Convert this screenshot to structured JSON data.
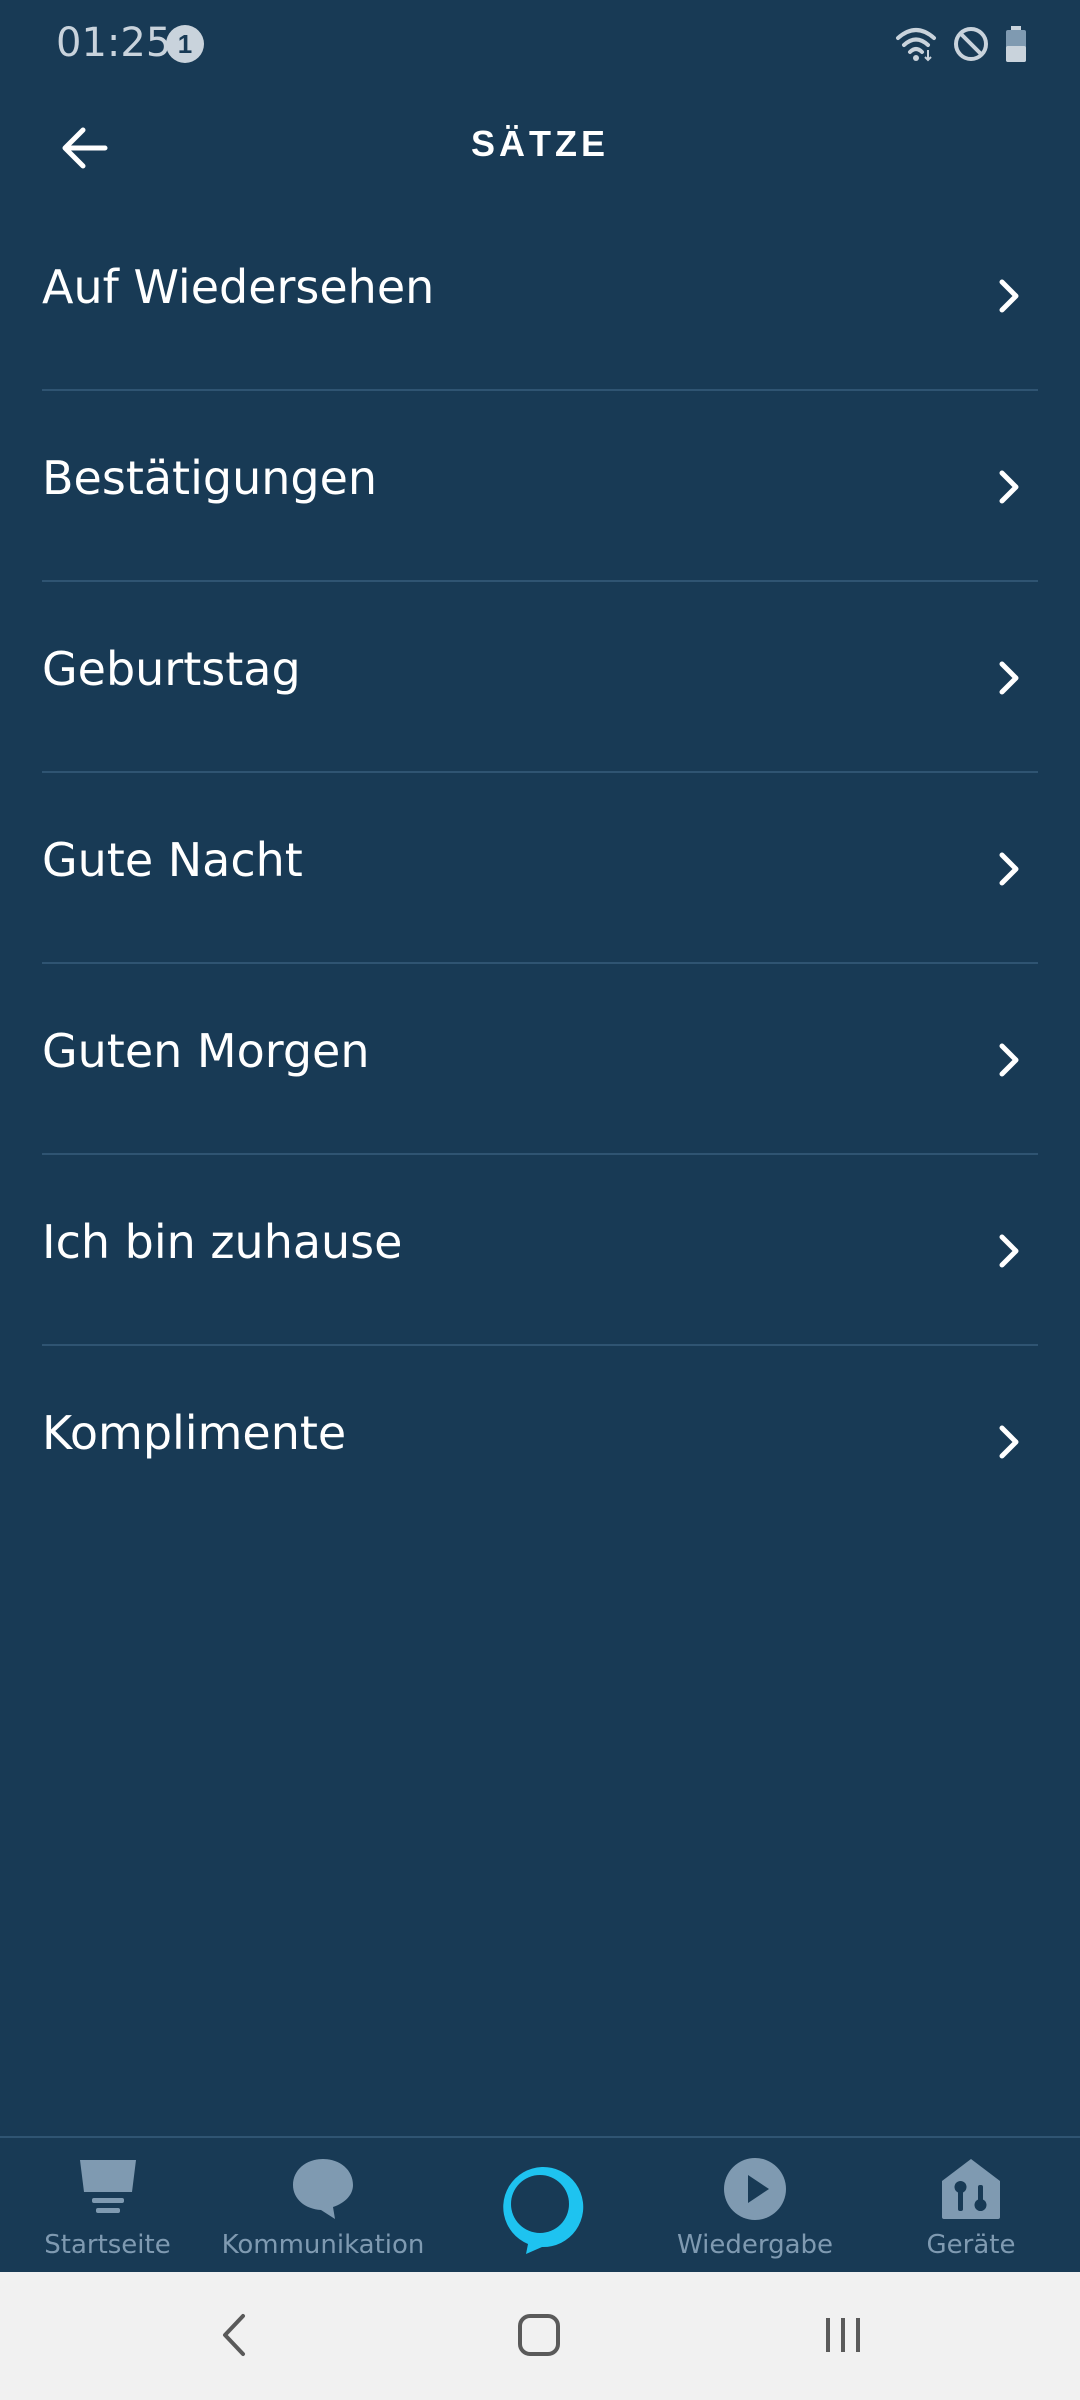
{
  "status_bar": {
    "time": "01:25",
    "notification_count": "1",
    "icons": [
      "wifi-icon",
      "do-not-disturb-icon",
      "battery-icon"
    ]
  },
  "header": {
    "back_icon": "arrow-left-icon",
    "title": "SÄTZE"
  },
  "list": {
    "items": [
      {
        "label": "Auf Wiedersehen"
      },
      {
        "label": "Bestätigungen"
      },
      {
        "label": "Geburtstag"
      },
      {
        "label": "Gute Nacht"
      },
      {
        "label": "Guten Morgen"
      },
      {
        "label": "Ich bin zuhause"
      },
      {
        "label": "Komplimente"
      }
    ]
  },
  "bottom_nav": {
    "items": [
      {
        "label": "Startseite",
        "icon": "home-icon"
      },
      {
        "label": "Kommunikation",
        "icon": "chat-bubble-icon"
      },
      {
        "label": "",
        "icon": "alexa-ring-icon"
      },
      {
        "label": "Wiedergabe",
        "icon": "play-icon"
      },
      {
        "label": "Geräte",
        "icon": "smart-home-icon"
      }
    ]
  },
  "system_nav": {
    "icons": [
      "back-icon",
      "home-icon",
      "recents-icon"
    ]
  },
  "colors": {
    "background": "#183a55",
    "divider": "#2f5472",
    "text": "#ffffff",
    "nav_inactive": "#7f9ab1",
    "alexa_accent": "#1ec3f0",
    "system_bar": "#f1f1f1"
  }
}
